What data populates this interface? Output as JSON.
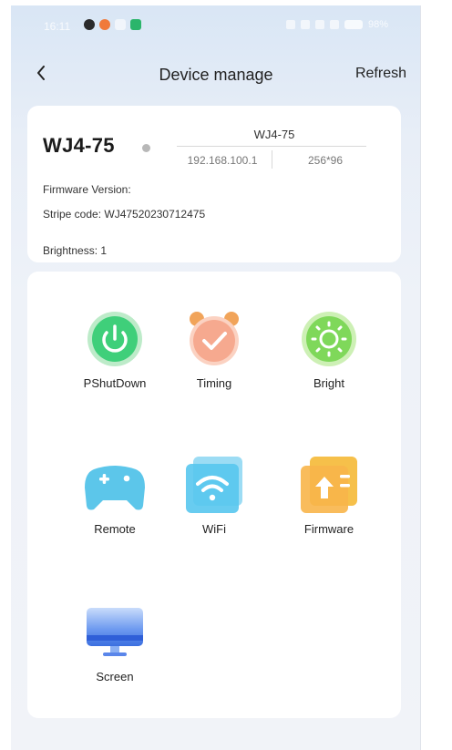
{
  "status_bar": {
    "time": "16:11",
    "battery": "98%"
  },
  "nav": {
    "title": "Device manage",
    "refresh_label": "Refresh"
  },
  "device": {
    "name": "WJ4-75",
    "display_name": "WJ4-75",
    "ip": "192.168.100.1",
    "resolution": "256*96",
    "firmware_line": "Firmware Version:",
    "stripe_line": "Stripe code: WJ47520230712475",
    "brightness_line": "Brightness: 1"
  },
  "functions": [
    {
      "label": "PShutDown",
      "icon": "power-icon"
    },
    {
      "label": "Timing",
      "icon": "alarm-clock-icon"
    },
    {
      "label": "Bright",
      "icon": "brightness-icon"
    },
    {
      "label": "Remote",
      "icon": "gamepad-icon"
    },
    {
      "label": "WiFi",
      "icon": "wifi-icon"
    },
    {
      "label": "Firmware",
      "icon": "firmware-upload-icon"
    },
    {
      "label": "Screen",
      "icon": "screen-icon"
    }
  ],
  "colors": {
    "power": "#3fcf7a",
    "timing": "#f6a98f",
    "bright": "#7fd85a",
    "remote": "#5cc6ea",
    "wifi": "#58c6ee",
    "firmware": "#f7b24a",
    "screen": "#3b6fe0"
  }
}
